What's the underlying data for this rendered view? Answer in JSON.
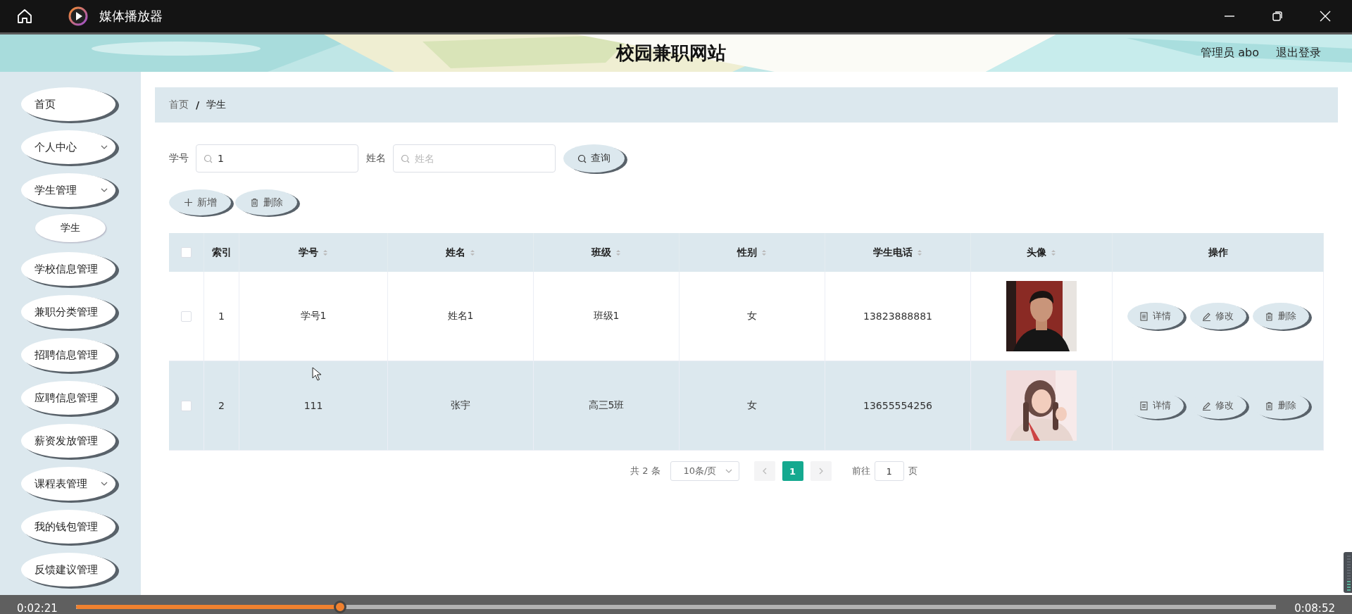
{
  "player": {
    "title": "媒体播放器",
    "elapsed": "0:02:21",
    "total": "0:08:52",
    "progress": {
      "level": 0.22
    }
  },
  "site": {
    "title": "校园兼职网站",
    "user": "管理员 abo",
    "logout": "退出登录"
  },
  "sidebar": {
    "items": [
      {
        "label": "首页",
        "has_submenu": false
      },
      {
        "label": "个人中心",
        "has_submenu": true
      },
      {
        "label": "学生管理",
        "has_submenu": true,
        "children": [
          {
            "label": "学生"
          }
        ]
      },
      {
        "label": "学校信息管理",
        "has_submenu": false
      },
      {
        "label": "兼职分类管理",
        "has_submenu": false
      },
      {
        "label": "招聘信息管理",
        "has_submenu": false
      },
      {
        "label": "应聘信息管理",
        "has_submenu": false
      },
      {
        "label": "薪资发放管理",
        "has_submenu": false
      },
      {
        "label": "课程表管理",
        "has_submenu": true
      },
      {
        "label": "我的钱包管理",
        "has_submenu": false
      },
      {
        "label": "反馈建议管理",
        "has_submenu": false
      }
    ]
  },
  "breadcrumb": {
    "items": [
      "首页",
      "学生"
    ],
    "separator": "/"
  },
  "search": {
    "fields": [
      {
        "label": "学号",
        "value": "1"
      },
      {
        "label": "姓名",
        "placeholder": "姓名"
      }
    ],
    "button": "查询"
  },
  "actions": [
    {
      "kind": "add",
      "label": "新增"
    },
    {
      "kind": "delete",
      "label": "删除"
    }
  ],
  "table": {
    "select_all": {
      "checked": false
    },
    "columns": [
      {
        "label": "索引",
        "sortable": false
      },
      {
        "label": "学号",
        "sortable": true
      },
      {
        "label": "姓名",
        "sortable": true
      },
      {
        "label": "班级",
        "sortable": true
      },
      {
        "label": "性别",
        "sortable": true
      },
      {
        "label": "学生电话",
        "sortable": true
      },
      {
        "label": "头像",
        "sortable": true
      },
      {
        "label": "操作",
        "sortable": false
      }
    ],
    "rows": [
      {
        "checked": false,
        "hovered": false,
        "cells": [
          "1",
          "学号1",
          "姓名1",
          "班级1",
          "女",
          "13823888881"
        ],
        "actions": [
          {
            "kind": "detail",
            "label": "详情"
          },
          {
            "kind": "edit",
            "label": "修改"
          },
          {
            "kind": "delete",
            "label": "删除"
          }
        ]
      },
      {
        "checked": false,
        "hovered": true,
        "cells": [
          "2",
          "111",
          "张宇",
          "高三5班",
          "女",
          "13655554256"
        ],
        "actions": [
          {
            "kind": "detail",
            "label": "详情"
          },
          {
            "kind": "edit",
            "label": "修改"
          },
          {
            "kind": "delete",
            "label": "删除"
          }
        ]
      }
    ]
  },
  "pagination": {
    "total": "共 2 条",
    "page_size": "10条/页",
    "pages": [
      {
        "label": "1",
        "selected": true
      }
    ],
    "goto_label": "前往",
    "goto_value": "1",
    "page_unit": "页"
  }
}
